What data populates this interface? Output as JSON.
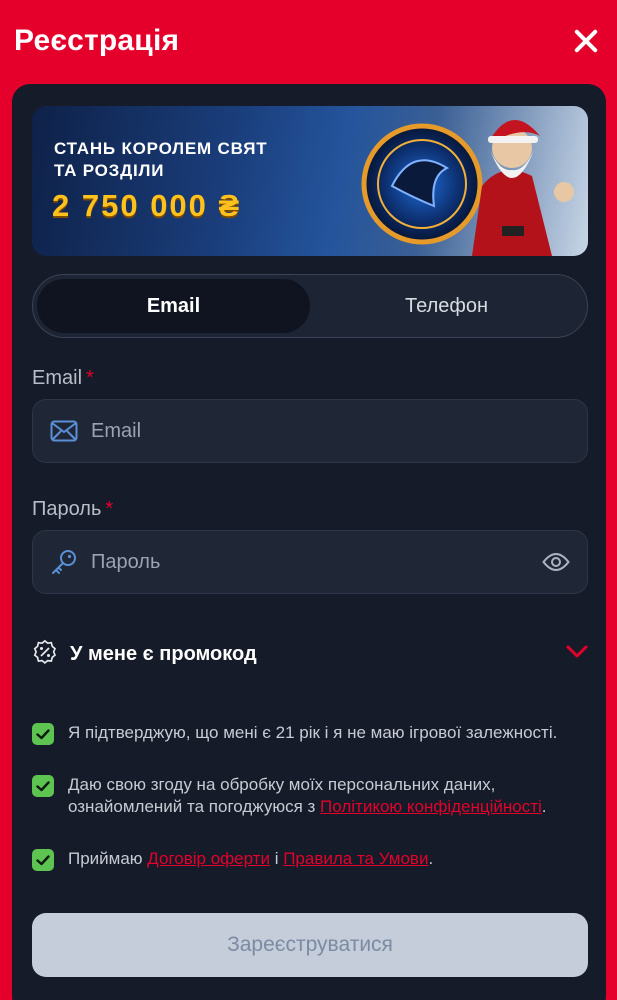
{
  "header": {
    "title": "Реєстрація"
  },
  "banner": {
    "line1": "СТАНЬ КОРОЛЕМ СВЯТ",
    "line2": "ТА РОЗДІЛИ",
    "amount": "2 750 000 ₴"
  },
  "tabs": [
    {
      "label": "Email",
      "active": true
    },
    {
      "label": "Телефон",
      "active": false
    }
  ],
  "email": {
    "label": "Email",
    "required_mark": "*",
    "placeholder": "Email",
    "value": ""
  },
  "password": {
    "label": "Пароль",
    "required_mark": "*",
    "placeholder": "Пароль",
    "value": ""
  },
  "promo": {
    "label": "У мене є  промокод"
  },
  "checks": {
    "age": {
      "text": "Я підтверджую, що мені є 21 рік і я не маю ігрової залежності.",
      "checked": true
    },
    "privacy": {
      "text_before": "Даю свою згоду на обробку моїх персональних даних, ознайомлений та погоджуюся з ",
      "link": "Політикою конфіденційності",
      "text_after": ".",
      "checked": true
    },
    "terms": {
      "text_before": "Приймаю ",
      "link1": "Договір оферти",
      "text_middle": " і ",
      "link2": "Правила та Умови",
      "text_after": ".",
      "checked": true
    }
  },
  "submit": {
    "label": "Зареєструватися"
  },
  "colors": {
    "brand_red": "#e4002b",
    "panel_bg": "#151b28",
    "check_green": "#5dc451",
    "amount_gold": "#ffc21c"
  }
}
